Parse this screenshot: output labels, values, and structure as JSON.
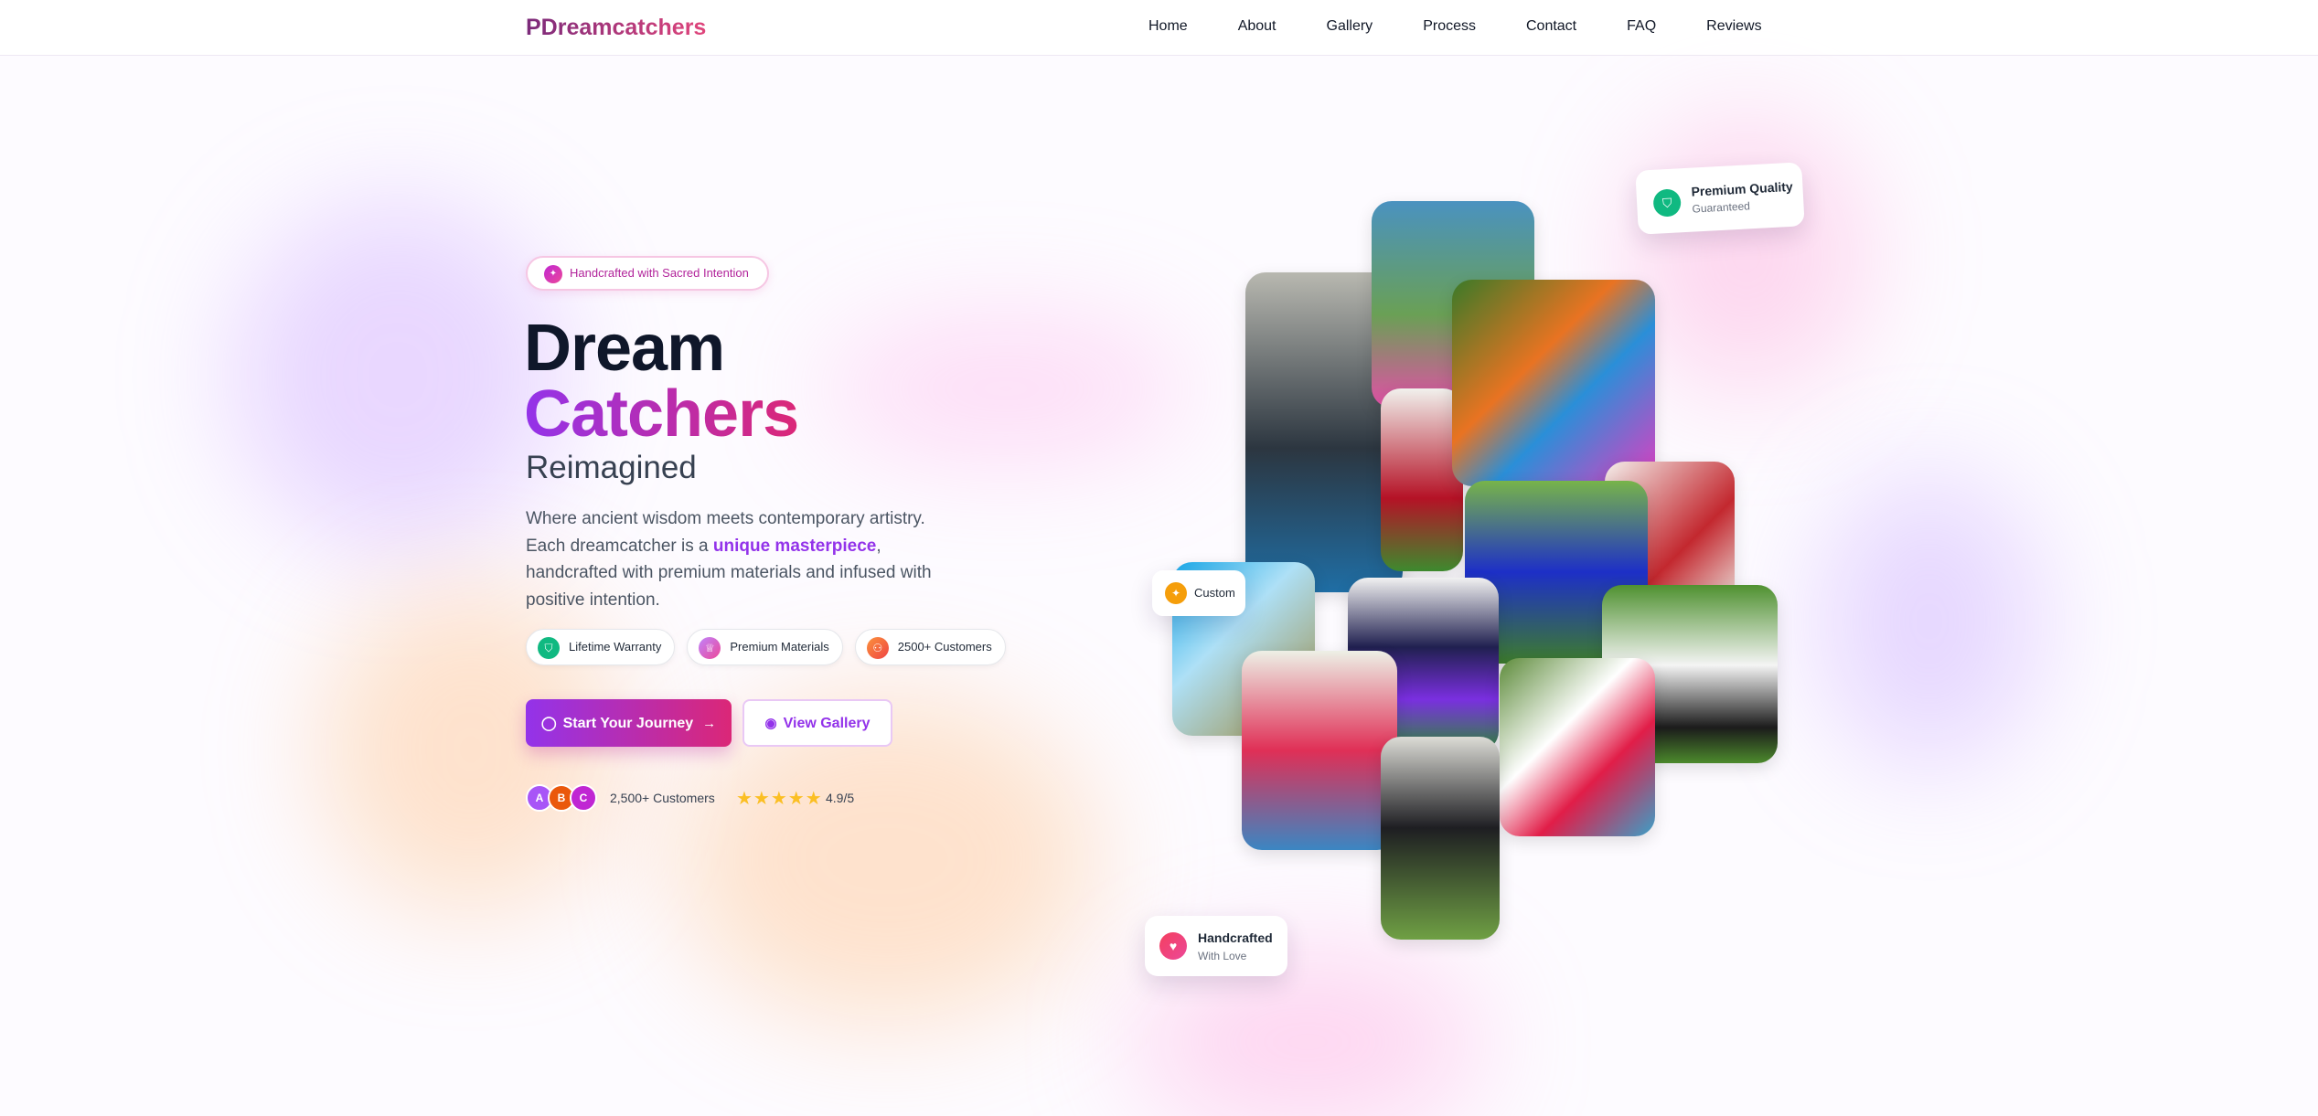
{
  "nav": {
    "logo": "PDreamcatchers",
    "links": [
      "Home",
      "About",
      "Gallery",
      "Process",
      "Contact",
      "FAQ",
      "Reviews"
    ]
  },
  "hero": {
    "badge": "Handcrafted with Sacred Intention",
    "title_line1": "Dream",
    "title_line2": "Catchers",
    "subtitle": "Reimagined",
    "desc_part1": "Where ancient wisdom meets contemporary artistry. Each dreamcatcher is a ",
    "desc_highlight": "unique masterpiece",
    "desc_part2": ", handcrafted with premium materials and infused with positive intention.",
    "pills": [
      "Lifetime Warranty",
      "Premium Materials",
      "2500+ Customers"
    ],
    "primary_button": "Start Your Journey",
    "secondary_button": "View Gallery",
    "avatars": [
      "A",
      "B",
      "C"
    ],
    "customers_text": "2,500+ Customers",
    "stars": "★★★★★",
    "rating": "4.9/5"
  },
  "floating": {
    "quality_title": "Premium Quality",
    "quality_sub": "Guaranteed",
    "custom": "Custom",
    "hand_title": "Handcrafted",
    "hand_sub": "With Love"
  },
  "colors": {
    "accent_purple": "#9333ea",
    "accent_pink": "#db2777",
    "quality_green": "#10b981",
    "custom_amber": "#f59e0b"
  }
}
